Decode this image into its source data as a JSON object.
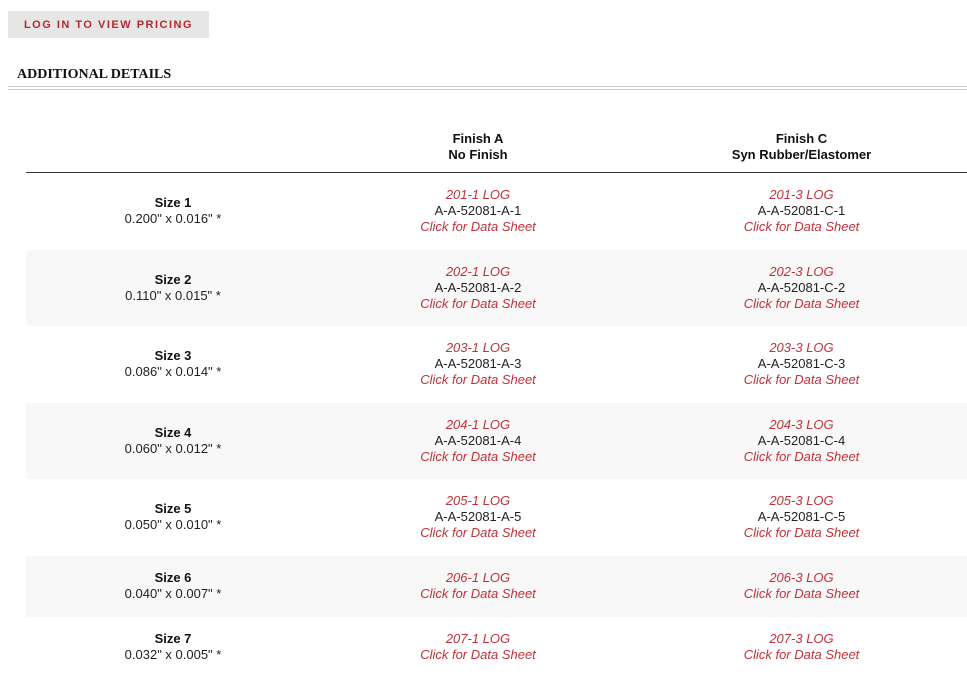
{
  "login_button": "LOG IN TO VIEW PRICING",
  "section_title": "ADDITIONAL DETAILS",
  "table": {
    "columns": [
      {
        "name": "Finish A",
        "sub": "No Finish"
      },
      {
        "name": "Finish C",
        "sub": "Syn Rubber/Elastomer"
      }
    ],
    "rows": [
      {
        "size": "Size 1",
        "dim": "0.200\" x 0.016\" *",
        "cells": [
          {
            "log": "201-1 LOG",
            "part": "A-A-52081-A-1",
            "sheet": "Click for Data Sheet"
          },
          {
            "log": "201-3 LOG",
            "part": "A-A-52081-C-1",
            "sheet": "Click for Data Sheet"
          }
        ]
      },
      {
        "size": "Size 2",
        "dim": "0.110\" x 0.015\" *",
        "cells": [
          {
            "log": "202-1 LOG",
            "part": "A-A-52081-A-2",
            "sheet": "Click for Data Sheet"
          },
          {
            "log": "202-3 LOG",
            "part": "A-A-52081-C-2",
            "sheet": "Click for Data Sheet"
          }
        ]
      },
      {
        "size": "Size 3",
        "dim": "0.086\" x 0.014\" *",
        "cells": [
          {
            "log": "203-1 LOG",
            "part": "A-A-52081-A-3",
            "sheet": "Click for Data Sheet"
          },
          {
            "log": "203-3 LOG",
            "part": "A-A-52081-C-3",
            "sheet": "Click for Data Sheet"
          }
        ]
      },
      {
        "size": "Size 4",
        "dim": "0.060\" x 0.012\" *",
        "cells": [
          {
            "log": "204-1 LOG",
            "part": "A-A-52081-A-4",
            "sheet": "Click for Data Sheet"
          },
          {
            "log": "204-3 LOG",
            "part": "A-A-52081-C-4",
            "sheet": "Click for Data Sheet"
          }
        ]
      },
      {
        "size": "Size 5",
        "dim": "0.050\" x 0.010\" *",
        "cells": [
          {
            "log": "205-1 LOG",
            "part": "A-A-52081-A-5",
            "sheet": "Click for Data Sheet"
          },
          {
            "log": "205-3 LOG",
            "part": "A-A-52081-C-5",
            "sheet": "Click for Data Sheet"
          }
        ]
      },
      {
        "size": "Size 6",
        "dim": "0.040\" x 0.007\" *",
        "cells": [
          {
            "log": "206-1 LOG",
            "sheet": "Click for Data Sheet"
          },
          {
            "log": "206-3 LOG",
            "sheet": "Click for Data Sheet"
          }
        ]
      },
      {
        "size": "Size 7",
        "dim": "0.032\" x 0.005\" *",
        "cells": [
          {
            "log": "207-1 LOG",
            "sheet": "Click for Data Sheet"
          },
          {
            "log": "207-3 LOG",
            "sheet": "Click for Data Sheet"
          }
        ]
      }
    ]
  }
}
